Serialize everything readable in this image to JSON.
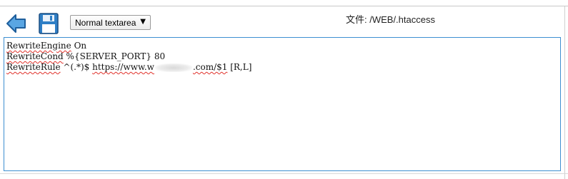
{
  "toolbar": {
    "back_icon": "back-arrow-icon",
    "save_icon": "floppy-disk-icon",
    "mode_select": {
      "selected": "Normal textarea"
    },
    "file_label": "文件: /WEB/.htaccess"
  },
  "editor": {
    "lines": [
      {
        "directive": "RewriteEngine",
        "args": " On"
      },
      {
        "directive": "RewriteCond",
        "args": " %{SERVER_PORT} 80"
      },
      {
        "directive": "RewriteRule",
        "args_pre": " ^(.*)$ ",
        "url_start": "https://www.w",
        "url_end": ".com/$1",
        "args_post": " [R,L]"
      }
    ]
  },
  "colors": {
    "accent_border": "#3d8fd1",
    "icon_blue": "#2f7fc6",
    "spellcheck": "#e0312a"
  }
}
